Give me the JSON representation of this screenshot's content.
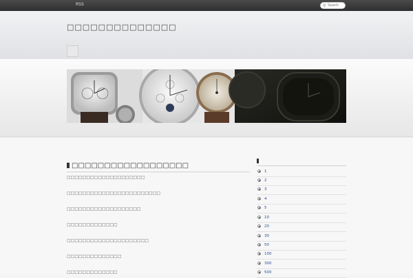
{
  "topbar": {
    "rss_label": "RSS",
    "search_placeholder": "Search"
  },
  "header": {
    "site_title": "□□□□□□□□□□□□□□"
  },
  "post": {
    "title": "□□□□□□□□□□□□□□□□□□",
    "lines": [
      "□□□□□□□□□□□□□□□□□□□□",
      "□□□□□□□□□□□□□□□□□□□□□□□□",
      "□□□□□□□□□□□□□□□□□□□",
      "□□□□□□□□□□□□□",
      "□□□□□□□□□□□□□□□□□□□□□",
      "□□□□□□□□□□□□□□",
      "□□□□□□□□□□□□□"
    ]
  },
  "sidebar": {
    "title": "",
    "items": [
      "1",
      "2",
      "3",
      "4",
      "5",
      "10",
      "20",
      "30",
      "50",
      "100",
      "300",
      "500"
    ]
  },
  "colors": {
    "topbar": "#333333",
    "link": "#2a4aa0"
  }
}
